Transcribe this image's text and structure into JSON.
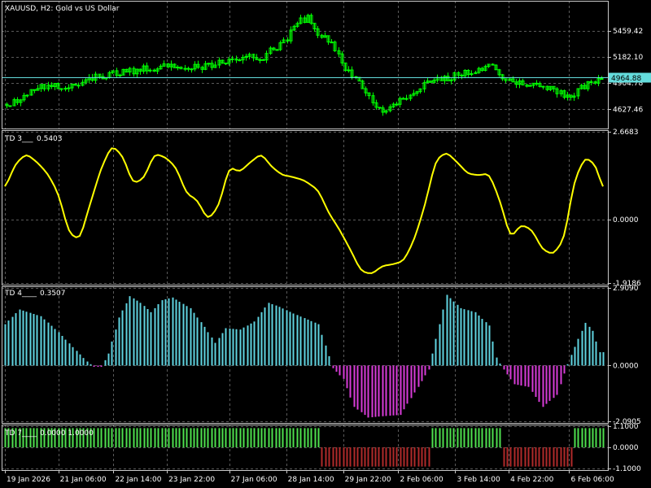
{
  "colors": {
    "background": "#000000",
    "grid": "#5a5a5a",
    "frame": "#c8c8c8",
    "candle": "#00ff00",
    "price_line": "#64dcdc",
    "price_tag_bg": "#64dcdc",
    "td3_line": "#ffff00",
    "td4_pos": "#5fd3e0",
    "td4_neg": "#d83cd8",
    "td7_pos": "#4ee04e",
    "td7_neg": "#b02a2a"
  },
  "chart_data": [
    {
      "type": "candlestick",
      "panel": "main",
      "title": "XAUUSD, H2:  Gold vs US Dollar",
      "current_price": "4964.88",
      "y_tick_labels": [
        "5459.42",
        "5182.10",
        "4904.78",
        "4627.46"
      ],
      "y_ticks": [
        5459.42,
        5182.1,
        4904.78,
        4627.46
      ],
      "ylim": [
        4440,
        5760
      ],
      "close_path": [
        [
          0,
          4680
        ],
        [
          6,
          4700
        ],
        [
          12,
          4790
        ],
        [
          20,
          4855
        ],
        [
          28,
          4875
        ],
        [
          34,
          4860
        ],
        [
          42,
          4885
        ],
        [
          50,
          4960
        ],
        [
          60,
          5000
        ],
        [
          70,
          5030
        ],
        [
          80,
          5060
        ],
        [
          90,
          5080
        ],
        [
          100,
          5090
        ],
        [
          108,
          5070
        ],
        [
          116,
          5100
        ],
        [
          126,
          5160
        ],
        [
          136,
          5180
        ],
        [
          144,
          5170
        ],
        [
          150,
          5260
        ],
        [
          158,
          5360
        ],
        [
          164,
          5560
        ],
        [
          170,
          5590
        ],
        [
          176,
          5440
        ],
        [
          184,
          5320
        ],
        [
          190,
          5080
        ],
        [
          196,
          4970
        ],
        [
          202,
          4840
        ],
        [
          206,
          4700
        ],
        [
          212,
          4610
        ],
        [
          218,
          4680
        ],
        [
          226,
          4770
        ],
        [
          236,
          4890
        ],
        [
          246,
          4950
        ],
        [
          256,
          5000
        ],
        [
          266,
          5040
        ],
        [
          272,
          5080
        ],
        [
          276,
          5050
        ],
        [
          282,
          4920
        ],
        [
          290,
          4900
        ],
        [
          298,
          4880
        ],
        [
          306,
          4860
        ],
        [
          312,
          4800
        ],
        [
          318,
          4760
        ],
        [
          324,
          4860
        ],
        [
          332,
          4930
        ],
        [
          342,
          4970
        ],
        [
          348,
          4980
        ]
      ],
      "wick_amplitude": 45,
      "candle_count": 175,
      "seed": 13
    },
    {
      "type": "line",
      "panel": "td3",
      "name": "TD 3___",
      "value_label": "0.5403",
      "y_tick_labels": [
        "2.6683",
        "0.0000",
        "-1.9186"
      ],
      "y_ticks": [
        2.6683,
        0,
        -1.9186
      ],
      "ylim": [
        -1.9186,
        2.6683
      ],
      "points": [
        [
          0,
          0.95
        ],
        [
          6,
          1.7
        ],
        [
          12,
          2.0
        ],
        [
          18,
          1.75
        ],
        [
          24,
          1.4
        ],
        [
          30,
          0.8
        ],
        [
          36,
          -0.4
        ],
        [
          42,
          -0.6
        ],
        [
          48,
          0.5
        ],
        [
          54,
          1.55
        ],
        [
          60,
          2.25
        ],
        [
          66,
          1.95
        ],
        [
          72,
          1.1
        ],
        [
          78,
          1.25
        ],
        [
          84,
          2.0
        ],
        [
          90,
          1.9
        ],
        [
          96,
          1.6
        ],
        [
          102,
          0.8
        ],
        [
          108,
          0.6
        ],
        [
          114,
          0.0
        ],
        [
          120,
          0.4
        ],
        [
          126,
          1.6
        ],
        [
          132,
          1.45
        ],
        [
          138,
          1.75
        ],
        [
          144,
          2.0
        ],
        [
          150,
          1.6
        ],
        [
          156,
          1.35
        ],
        [
          160,
          1.32
        ],
        [
          168,
          1.2
        ],
        [
          176,
          0.9
        ],
        [
          182,
          0.2
        ],
        [
          188,
          -0.3
        ],
        [
          194,
          -0.9
        ],
        [
          200,
          -1.55
        ],
        [
          206,
          -1.65
        ],
        [
          212,
          -1.4
        ],
        [
          218,
          -1.35
        ],
        [
          224,
          -1.25
        ],
        [
          230,
          -0.6
        ],
        [
          236,
          0.45
        ],
        [
          242,
          1.8
        ],
        [
          248,
          2.05
        ],
        [
          254,
          1.75
        ],
        [
          260,
          1.4
        ],
        [
          266,
          1.35
        ],
        [
          272,
          1.4
        ],
        [
          278,
          0.6
        ],
        [
          284,
          -0.55
        ],
        [
          290,
          -0.15
        ],
        [
          296,
          -0.3
        ],
        [
          302,
          -0.9
        ],
        [
          308,
          -1.05
        ],
        [
          314,
          -0.6
        ],
        [
          320,
          1.2
        ],
        [
          326,
          1.9
        ],
        [
          332,
          1.65
        ],
        [
          338,
          0.55
        ]
      ]
    },
    {
      "type": "histogram",
      "panel": "td4",
      "name": "TD 4____",
      "value_label": "0.3507",
      "y_tick_labels": [
        "2.9090",
        "0.0000",
        "-2.0905"
      ],
      "y_ticks": [
        2.909,
        0,
        -2.0905
      ],
      "ylim": [
        -2.0905,
        2.909
      ],
      "bar_count": 169,
      "envelope": [
        [
          0,
          1.55
        ],
        [
          8,
          2.1
        ],
        [
          20,
          1.85
        ],
        [
          30,
          1.25
        ],
        [
          40,
          0.55
        ],
        [
          46,
          0.15
        ],
        [
          50,
          -0.05
        ],
        [
          54,
          -0.05
        ],
        [
          58,
          0.45
        ],
        [
          64,
          1.8
        ],
        [
          70,
          2.6
        ],
        [
          76,
          2.35
        ],
        [
          82,
          2.0
        ],
        [
          88,
          2.45
        ],
        [
          94,
          2.55
        ],
        [
          104,
          2.15
        ],
        [
          112,
          1.45
        ],
        [
          118,
          0.85
        ],
        [
          124,
          1.4
        ],
        [
          132,
          1.35
        ],
        [
          140,
          1.65
        ],
        [
          148,
          2.35
        ],
        [
          154,
          2.2
        ],
        [
          162,
          1.95
        ],
        [
          176,
          1.55
        ],
        [
          182,
          0.35
        ],
        [
          184,
          -0.1
        ],
        [
          190,
          -0.5
        ],
        [
          196,
          -1.55
        ],
        [
          204,
          -1.95
        ],
        [
          212,
          -1.9
        ],
        [
          222,
          -1.85
        ],
        [
          232,
          -0.8
        ],
        [
          238,
          -0.15
        ],
        [
          240,
          0.45
        ],
        [
          248,
          2.65
        ],
        [
          256,
          2.15
        ],
        [
          264,
          2.0
        ],
        [
          272,
          1.5
        ],
        [
          276,
          0.3
        ],
        [
          280,
          -0.15
        ],
        [
          286,
          -0.7
        ],
        [
          294,
          -0.8
        ],
        [
          302,
          -1.55
        ],
        [
          310,
          -1.1
        ],
        [
          314,
          -0.3
        ],
        [
          318,
          0.4
        ],
        [
          326,
          1.6
        ],
        [
          330,
          1.3
        ],
        [
          334,
          0.5
        ]
      ]
    },
    {
      "type": "histogram",
      "panel": "td7",
      "name": "TD 7____",
      "value_label": "0.0000 1.0000",
      "y_tick_labels": [
        "1.1000",
        "0.0000",
        "-1.1000"
      ],
      "y_ticks": [
        1.1,
        0,
        -1.1
      ],
      "ylim": [
        -1.1,
        1.1
      ],
      "bar_count": 169,
      "segments": [
        [
          0,
          177,
          1
        ],
        [
          178,
          239,
          -1
        ],
        [
          240,
          279,
          1
        ],
        [
          280,
          318,
          -1
        ],
        [
          319,
          336,
          1
        ]
      ]
    }
  ],
  "x_axis": {
    "labels": [
      "19 Jan 2026",
      "21 Jan 06:00",
      "22 Jan 14:00",
      "23 Jan 22:00",
      "27 Jan 06:00",
      "28 Jan 14:00",
      "29 Jan 22:00",
      "2 Feb 06:00",
      "3 Feb 14:00",
      "4 Feb 22:00",
      "6 Feb 06:00"
    ],
    "label_index": [
      0,
      30,
      61,
      91,
      126,
      158,
      190,
      221,
      253,
      283,
      317
    ],
    "range": [
      0,
      336
    ]
  }
}
